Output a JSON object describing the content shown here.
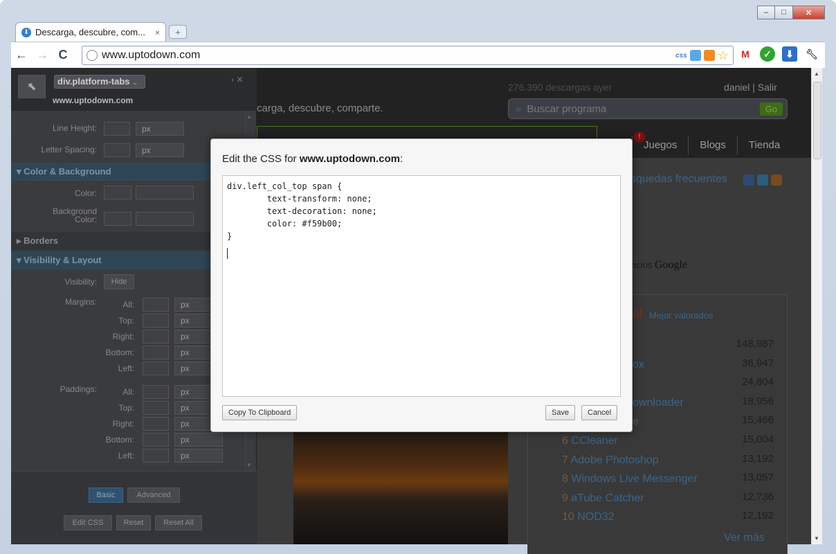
{
  "window": {
    "tab_title": "Descarga, descubre, com...",
    "tab_close": "×",
    "new_tab_icon": "+",
    "controls": [
      "‒",
      "□",
      "✕"
    ]
  },
  "toolbar": {
    "back": "←",
    "forward": "→",
    "reload": "C",
    "url": "www.uptodown.com",
    "css_label": "css"
  },
  "site": {
    "downloads_stat": "276.390 descargas ayer",
    "user": "daniel  |  Salir",
    "tagline": "carga, descubre, comparte.",
    "search_placeholder": "Buscar programa",
    "search_go": "Go",
    "menu": [
      "Juegos",
      "Blogs",
      "Tienda"
    ],
    "menu_badge": "!",
    "frequent_searches": "squedas frecuentes",
    "ads_prefix": "ncios ",
    "ads_google": "Google",
    "ranking_head": "al",
    "ranking_sub": "Mejor valorados",
    "ranking": [
      {
        "num": "",
        "name": "",
        "value": "148,987"
      },
      {
        "num": "",
        "name": "ox",
        "value": "36,947"
      },
      {
        "num": "",
        "name": "",
        "value": "24,804"
      },
      {
        "num": "",
        "name": "ownloader",
        "value": "18,956"
      },
      {
        "num": "",
        "name": "e",
        "value": "15,466"
      },
      {
        "num": "6",
        "name": "CCleaner",
        "value": "15,004"
      },
      {
        "num": "7",
        "name": "Adobe Photoshop",
        "value": "13,192"
      },
      {
        "num": "8",
        "name": "Windows Live Messenger",
        "value": "13,057"
      },
      {
        "num": "9",
        "name": "aTube Catcher",
        "value": "12,736"
      },
      {
        "num": "10",
        "name": "NOD32",
        "value": "12,192"
      }
    ],
    "see_more": "Ver más"
  },
  "inspector": {
    "selector": "div.platform-tabs",
    "host": "www.uptodown.com",
    "line_height_label": "Line Height:",
    "letter_spacing_label": "Letter Spacing:",
    "unit_px": "px",
    "section_color": "▾ Color & Background",
    "color_label": "Color:",
    "bg_color_label_1": "Background",
    "bg_color_label_2": "Color:",
    "section_borders": "▸ Borders",
    "section_visibility": "▾ Visibility & Layout",
    "visibility_label": "Visibility:",
    "hide_button": "Hide",
    "margins_label": "Margins:",
    "paddings_label": "Paddings:",
    "side_labels": [
      "All:",
      "Top:",
      "Right:",
      "Bottom:",
      "Left:"
    ],
    "basic_button": "Basic",
    "advanced_button": "Advanced",
    "edit_css_button": "Edit CSS",
    "reset_button": "Reset",
    "reset_all_button": "Reset All"
  },
  "modal": {
    "title_prefix": "Edit the CSS for ",
    "title_host": "www.uptodown.com",
    "title_suffix": ":",
    "code_lines": [
      "div.left_col_top span {",
      "        text-transform: none;",
      "        text-decoration: none;",
      "        color: #f59b00;",
      "}"
    ],
    "copy_button": "Copy To Clipboard",
    "save_button": "Save",
    "cancel_button": "Cancel"
  }
}
